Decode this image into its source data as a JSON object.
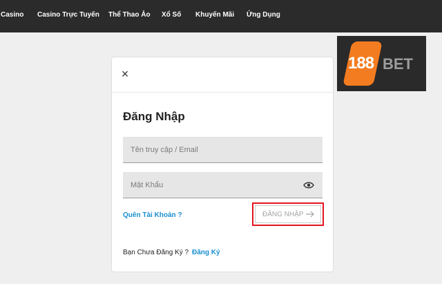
{
  "nav": {
    "items": [
      {
        "label": "Casino"
      },
      {
        "label": "Casino Trực Tuyến"
      },
      {
        "label": "Thể Thao Ảo"
      },
      {
        "label": "Xổ Số"
      },
      {
        "label": "Khuyến Mãi"
      },
      {
        "label": "Ứng Dụng"
      }
    ]
  },
  "logo": {
    "number": "188",
    "brand": "BET"
  },
  "login": {
    "title": "Đăng Nhập",
    "username_placeholder": "Tên truy cập / Email",
    "password_placeholder": "Mật Khẩu",
    "forgot_label": "Quên Tài Khoản ?",
    "submit_label": "ĐĂNG NHẬP",
    "register_prompt": "Bạn Chưa Đăng Ký ?",
    "register_link": "Đăng Ký"
  },
  "icons": {
    "close": "close-icon",
    "eye": "eye-icon",
    "arrow": "arrow-right-icon"
  },
  "colors": {
    "nav_bg": "#2b2b2b",
    "link": "#1a8fd0",
    "highlight": "#e3141e",
    "logo_orange": "#f47c20"
  }
}
